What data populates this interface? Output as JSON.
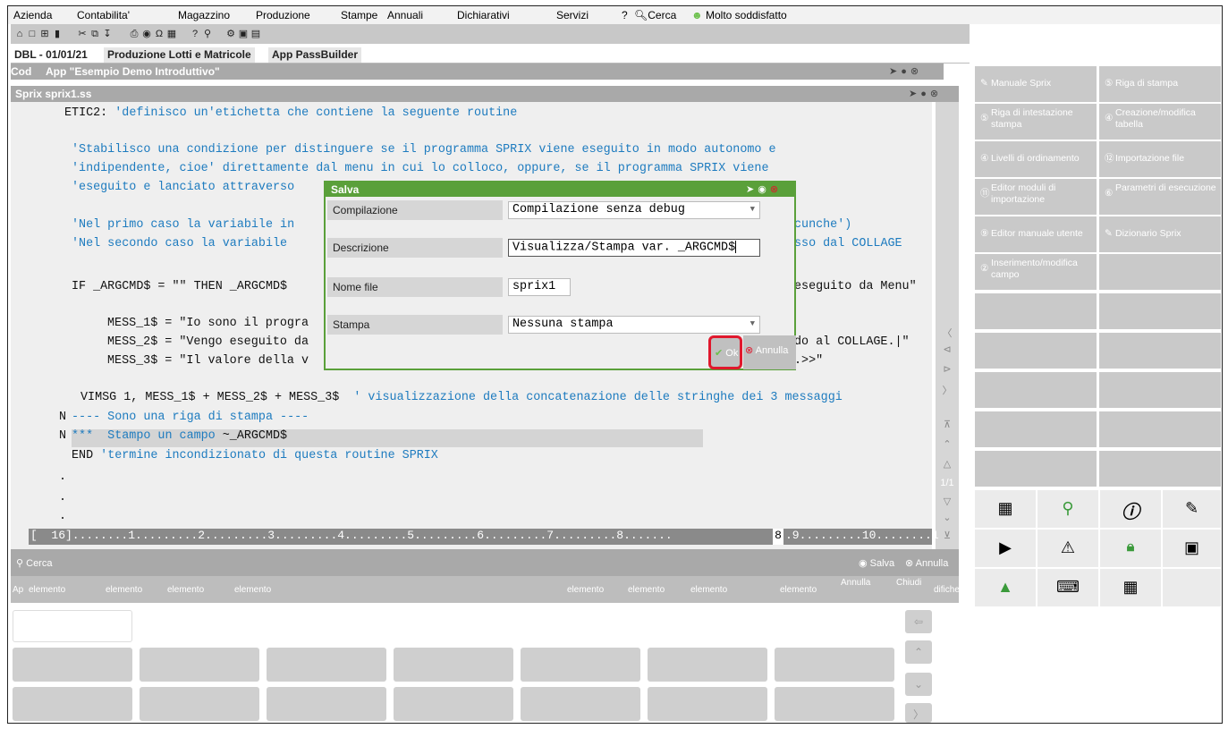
{
  "menubar": {
    "items": [
      {
        "label": "Azienda"
      },
      {
        "label": "Contabilita'"
      },
      {
        "label": "Magazzino"
      },
      {
        "label": "Produzione"
      },
      {
        "label": "Stampe"
      },
      {
        "label": "Annuali"
      },
      {
        "label": "Dichiarativi"
      },
      {
        "label": "Servizi"
      },
      {
        "label": "?"
      },
      {
        "label": "Cerca"
      },
      {
        "label": "Molto soddisfatto"
      }
    ]
  },
  "tabs": {
    "items": [
      {
        "label": "DBL - 01/01/21"
      },
      {
        "label": "Produzione Lotti e Matricole"
      },
      {
        "label": "App PassBuilder"
      }
    ]
  },
  "app_window": {
    "cod": "Cod",
    "title": "App \"Esempio Demo Introduttivo\""
  },
  "sprix_window": {
    "title": "Sprix sprix1.ss"
  },
  "code": {
    "l1_pre": "ETIC2: ",
    "l1_cmt": "'definisco un'etichetta che contiene la seguente routine",
    "l2_a": "'Stabilisco una condizione per distinguere se il programma ",
    "l2_b": "SPRIX",
    "l2_c": " viene eseguito in modo autonomo e",
    "l3_a": "'indipendente, cioe' direttamente dal menu in cui lo colloco, oppure, se il programma ",
    "l3_b": "SPRIX",
    "l3_c": " viene",
    "l4": "'eseguito e lanciato attraverso",
    "l5_a": "'Nel primo caso la variabile in",
    "l5_b": "cunche')",
    "l6_a": "'Nel secondo caso la variabile ",
    "l6_b": "sso dal ",
    "l6_c": "COLLAGE",
    "l7_a": "IF _ARGCMD$ = \"\" THEN _ARGCMD$",
    "l7_b": "eseguito da Menu\"",
    "l8": "MESS_1$ = \"Io sono il progra",
    "l9_a": "MESS_2$ = \"Vengo eseguito da",
    "l9_b": "do al COLLAGE.|\"",
    "l10_a": "MESS_3$ = \"Il valore della v",
    "l10_b": ".>>\"",
    "l11_a": "VIMSG 1, MESS_1$ + MESS_2$ + MESS_3$  ",
    "l11_b": "' visualizzazione della concatenazione delle stringhe dei 3 messaggi",
    "l12_n": "N",
    "l12": "---- Sono una riga di stampa ----",
    "l13_n": "N",
    "l13_a": "***  Stampo un campo ",
    "l13_b": "~_ARGCMD$",
    "l14_a": "END ",
    "l14_b": "'termine incondizionato di questa routine SPRIX",
    "dot": "."
  },
  "ruler": {
    "text": "[  16]........1.........2.........3.........4.........5.........6.........7.........8.......",
    "mark": "8",
    "tail": ".9.........10........1"
  },
  "searchbar": {
    "cerca": "Cerca",
    "salva": "Salva",
    "annulla": "Annulla"
  },
  "elemrow": {
    "items": [
      {
        "label": "Ap"
      },
      {
        "label": "elemento"
      },
      {
        "label": "elemento"
      },
      {
        "label": "elemento"
      },
      {
        "label": "elemento"
      },
      {
        "label": "elemento"
      },
      {
        "label": "elemento"
      },
      {
        "label": "elemento"
      },
      {
        "label": "elemento"
      },
      {
        "label": "Annulla"
      },
      {
        "label": "Chiudi"
      },
      {
        "label": "difiche"
      }
    ]
  },
  "right_panel": {
    "buttons": [
      {
        "label": "Manuale Sprix"
      },
      {
        "label": "Riga di stampa"
      },
      {
        "label": "Riga di intestazione stampa"
      },
      {
        "label": "Creazione/modifica tabella"
      },
      {
        "label": "Livelli di ordinamento"
      },
      {
        "label": "Importazione file"
      },
      {
        "label": "Editor moduli di importazione"
      },
      {
        "label": "Parametri di esecuzione"
      },
      {
        "label": "Editor manuale utente"
      },
      {
        "label": "Dizionario Sprix"
      },
      {
        "label": "Inserimento/modifica campo"
      }
    ]
  },
  "dialog": {
    "title": "Salva",
    "rows": [
      {
        "label": "Compilazione",
        "value": "Compilazione senza debug"
      },
      {
        "label": "Descrizione",
        "value": "Visualizza/Stampa var. _ARGCMD$"
      },
      {
        "label": "Nome file",
        "value": "sprix1"
      },
      {
        "label": "Stampa",
        "value": "Nessuna stampa"
      }
    ],
    "ok": "Ok",
    "annulla": "Annulla"
  },
  "colors": {
    "dialog_accent": "#5aa03a",
    "highlight": "#e0182d",
    "comment": "#1d7bbf"
  }
}
